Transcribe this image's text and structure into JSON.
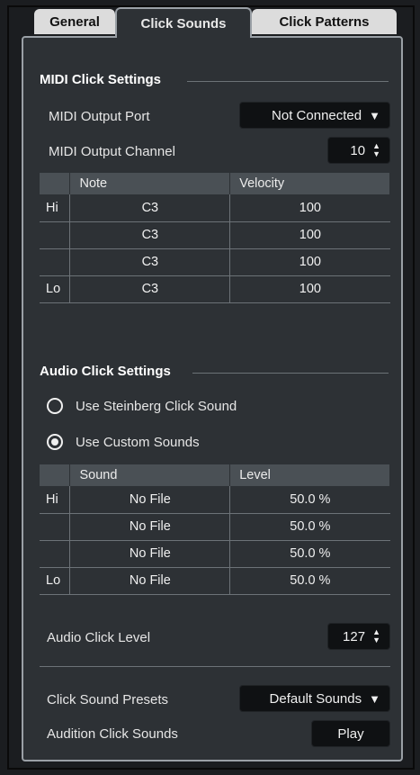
{
  "tabs": [
    {
      "label": "General",
      "active": false
    },
    {
      "label": "Click Sounds",
      "active": true
    },
    {
      "label": "Click Patterns",
      "active": false
    }
  ],
  "midi": {
    "title": "MIDI Click Settings",
    "output_port_label": "MIDI Output Port",
    "output_port_value": "Not Connected",
    "output_channel_label": "MIDI Output Channel",
    "output_channel_value": "10",
    "table": {
      "headers": [
        "",
        "Note",
        "Velocity"
      ],
      "rows": [
        [
          "Hi",
          "C3",
          "100"
        ],
        [
          "",
          "C3",
          "100"
        ],
        [
          "",
          "C3",
          "100"
        ],
        [
          "Lo",
          "C3",
          "100"
        ]
      ]
    }
  },
  "audio": {
    "title": "Audio Click Settings",
    "radio_steinberg": "Use Steinberg Click Sound",
    "radio_custom": "Use Custom Sounds",
    "selected_radio": "custom",
    "table": {
      "headers": [
        "",
        "Sound",
        "Level"
      ],
      "rows": [
        [
          "Hi",
          "No File",
          "50.0 %"
        ],
        [
          "",
          "No File",
          "50.0 %"
        ],
        [
          "",
          "No File",
          "50.0 %"
        ],
        [
          "Lo",
          "No File",
          "50.0 %"
        ]
      ]
    },
    "click_level_label": "Audio Click Level",
    "click_level_value": "127"
  },
  "presets": {
    "label": "Click Sound Presets",
    "value": "Default Sounds",
    "audition_label": "Audition Click Sounds",
    "play_label": "Play"
  },
  "colors": {
    "panel_bg": "#2d3135",
    "field_bg": "#0f1113",
    "header_bg": "#4a5055"
  }
}
